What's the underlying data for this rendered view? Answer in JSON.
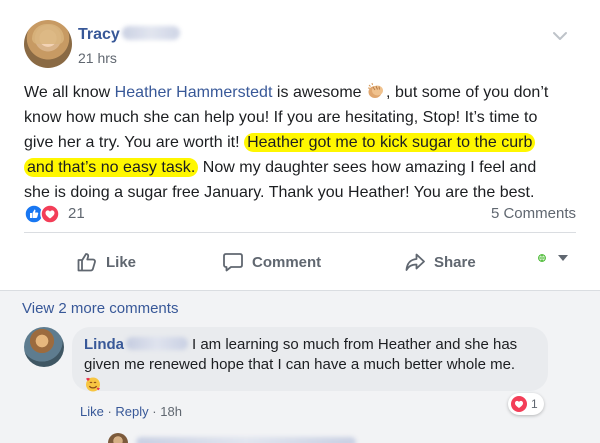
{
  "post": {
    "author_first": "Tracy",
    "time": "21 hrs",
    "text": {
      "l1_a": "We all know ",
      "mention": "Heather Hammerstedt",
      "l1_b": " is awesome ",
      "l1_c": ", but some of you don’t",
      "l2": "know how much she can help you! If you are hesitating, Stop! It’s time to",
      "l3_a": "give her a try. You are worth it! ",
      "l3_hl": "Heather got me to kick sugar to the curb",
      "l4_hl": "and that’s no easy task.",
      "l4_b": " Now my daughter sees how amazing I feel and",
      "l5": "she is doing a sugar free January. Thank you Heather! You are the best."
    },
    "reactions_count": "21",
    "comments_count": "5 Comments"
  },
  "actions": {
    "like": "Like",
    "comment": "Comment",
    "share": "Share"
  },
  "comments": {
    "view_more": "View 2 more comments",
    "first": {
      "author_first": "Linda",
      "text_l1": "I am learning so much from Heather and she has",
      "text_l2": "given me renewed hope that I can have a much better whole me.",
      "reaction_count": "1",
      "like": "Like",
      "sep": " · ",
      "reply": "Reply",
      "time": "18h"
    }
  },
  "colors": {
    "link": "#385898",
    "highlight": "#fff700",
    "like_blue": "#1877f2",
    "love_red": "#f33e58"
  }
}
